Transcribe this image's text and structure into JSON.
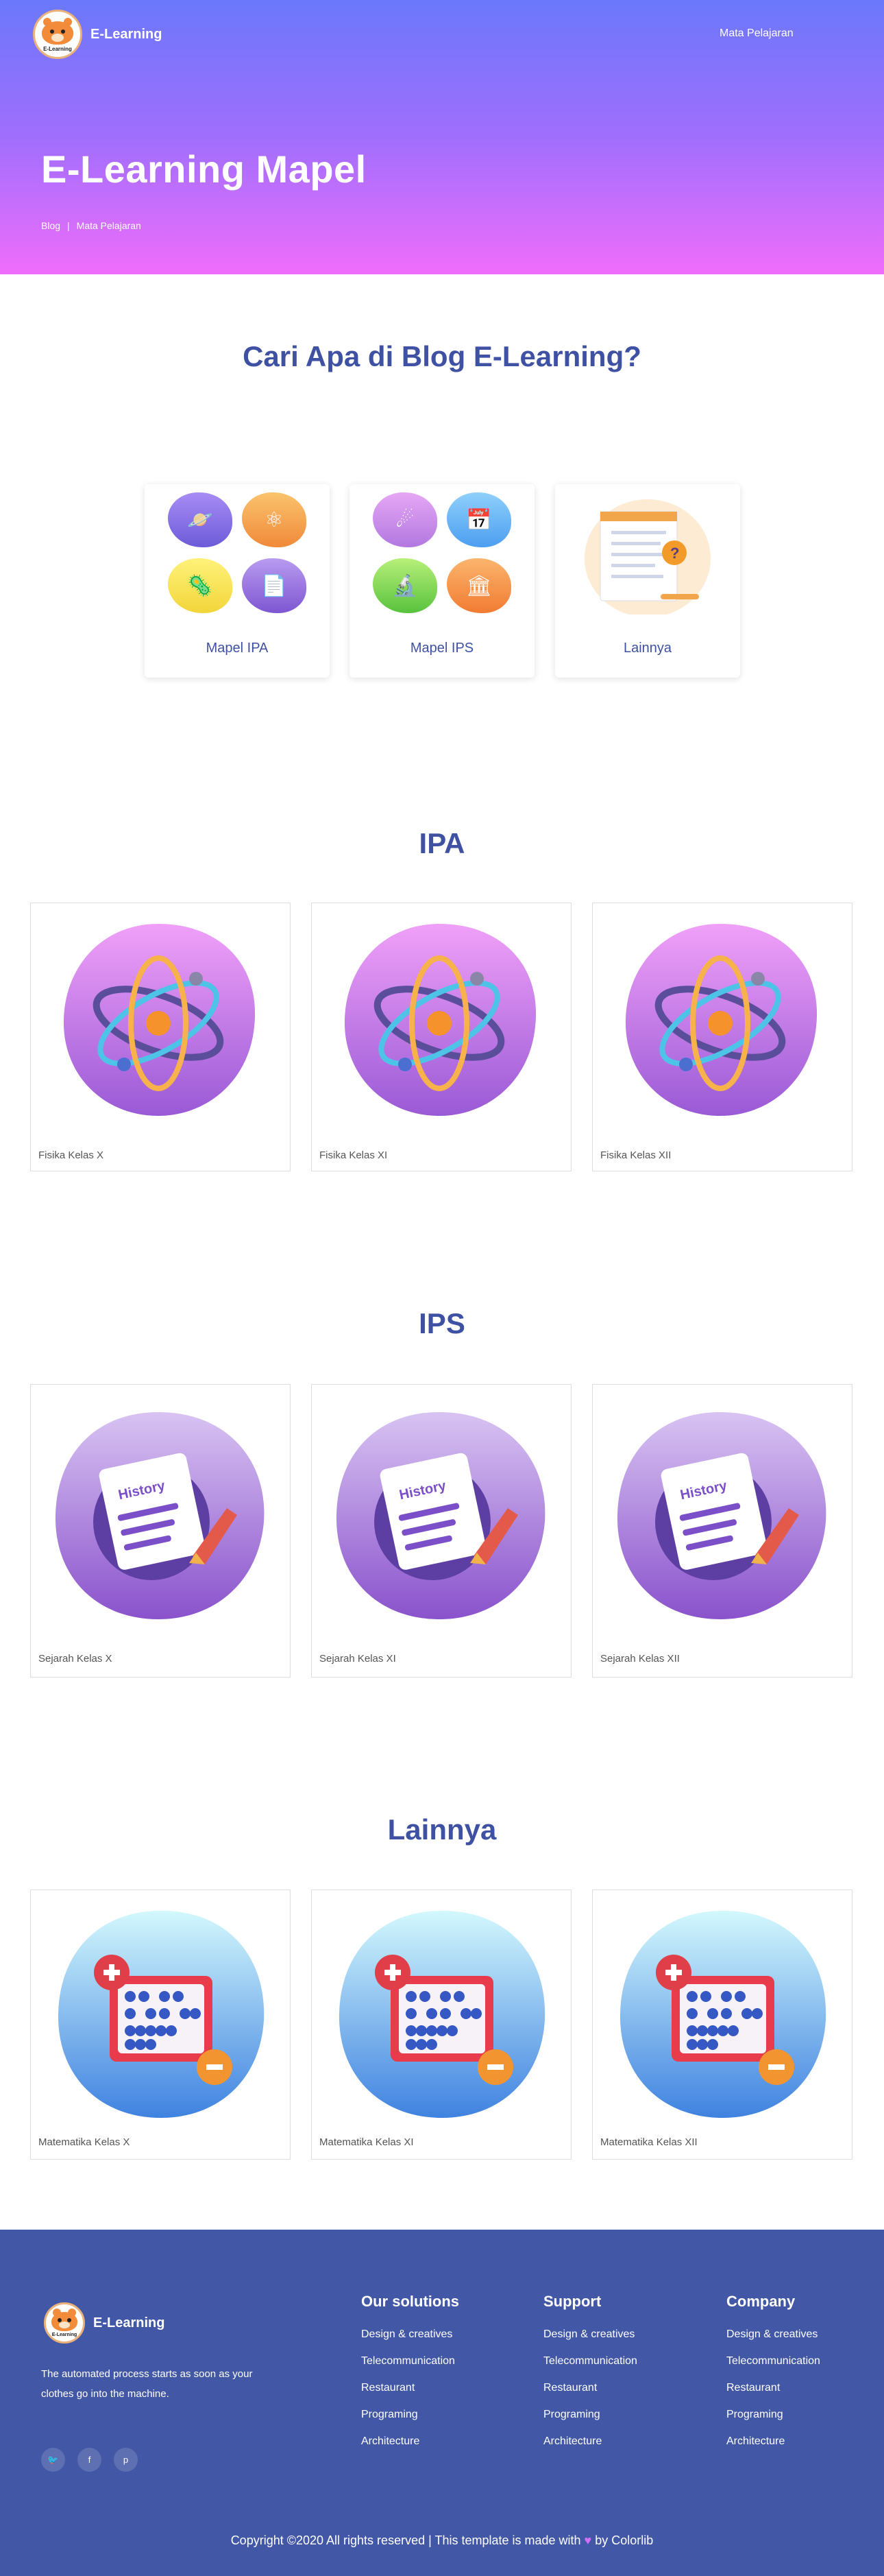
{
  "nav": {
    "brand": "E-Learning",
    "logo_text": "E-Learning",
    "link": "Mata Pelajaran"
  },
  "hero": {
    "title": "E-Learning Mapel",
    "crumb_home": "Blog",
    "crumb_sep": "|",
    "crumb_current": "Mata Pelajaran"
  },
  "search_section": {
    "title": "Cari Apa di Blog E-Learning?"
  },
  "categories": [
    {
      "label": "Mapel IPA"
    },
    {
      "label": "Mapel IPS"
    },
    {
      "label": "Lainnya"
    }
  ],
  "sections": {
    "ipa": {
      "title": "IPA",
      "items": [
        {
          "label": "Fisika Kelas X"
        },
        {
          "label": "Fisika Kelas XI"
        },
        {
          "label": "Fisika Kelas XII"
        }
      ]
    },
    "ips": {
      "title": "IPS",
      "items": [
        {
          "label": "Sejarah Kelas X"
        },
        {
          "label": "Sejarah Kelas XI"
        },
        {
          "label": "Sejarah Kelas XII"
        }
      ]
    },
    "lainnya": {
      "title": "Lainnya",
      "items": [
        {
          "label": "Matematika Kelas X"
        },
        {
          "label": "Matematika Kelas XI"
        },
        {
          "label": "Matematika Kelas XII"
        }
      ]
    }
  },
  "history_label": "History",
  "footer": {
    "brand": "E-Learning",
    "logo_text": "E-Learning",
    "description": "The automated process starts as soon as your clothes go into the machine.",
    "socials": [
      "twitter-icon",
      "facebook-icon",
      "pinterest-icon"
    ],
    "columns": [
      {
        "title": "Our solutions",
        "items": [
          "Design & creatives",
          "Telecommunication",
          "Restaurant",
          "Programing",
          "Architecture"
        ]
      },
      {
        "title": "Support",
        "items": [
          "Design & creatives",
          "Telecommunication",
          "Restaurant",
          "Programing",
          "Architecture"
        ]
      },
      {
        "title": "Company",
        "items": [
          "Design & creatives",
          "Telecommunication",
          "Restaurant",
          "Programing",
          "Architecture"
        ]
      }
    ],
    "copyright_pre": "Copyright ©2020 All rights reserved | This template is made with",
    "copyright_post": "by Colorlib"
  },
  "colors": {
    "hero_top": "#6b78fb",
    "hero_bottom": "#f06dfb",
    "heading": "#3f51a2",
    "footer": "#4257a5"
  }
}
